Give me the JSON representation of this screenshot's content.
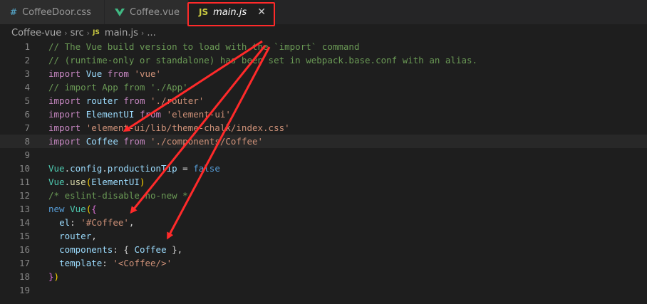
{
  "tabs": [
    {
      "label": "CoffeeDoor.css",
      "icon": "css-hash-icon"
    },
    {
      "label": "Coffee.vue",
      "icon": "vue-icon"
    },
    {
      "label": "main.js",
      "icon": "js-icon",
      "icon_text": "JS",
      "active": true,
      "close": "✕"
    }
  ],
  "breadcrumb": {
    "items": [
      "Coffee-vue",
      "src",
      "main.js",
      "..."
    ],
    "js_badge": "JS",
    "separator": "›"
  },
  "editor": {
    "current_line": 8,
    "lines": [
      {
        "n": "1",
        "tokens": [
          [
            "c-cm",
            "// The Vue build version to load with the `import` command"
          ]
        ]
      },
      {
        "n": "2",
        "tokens": [
          [
            "c-cm",
            "// (runtime-only or standalone) has been set in webpack.base.conf with an alias."
          ]
        ]
      },
      {
        "n": "3",
        "tokens": [
          [
            "c-kw2",
            "import"
          ],
          [
            "",
            " "
          ],
          [
            "c-var",
            "Vue"
          ],
          [
            "",
            " "
          ],
          [
            "c-kw2",
            "from"
          ],
          [
            "",
            " "
          ],
          [
            "c-str",
            "'vue'"
          ]
        ]
      },
      {
        "n": "4",
        "tokens": [
          [
            "c-cm",
            "// import App from './App'"
          ]
        ]
      },
      {
        "n": "5",
        "tokens": [
          [
            "c-kw2",
            "import"
          ],
          [
            "",
            " "
          ],
          [
            "c-var",
            "router"
          ],
          [
            "",
            " "
          ],
          [
            "c-kw2",
            "from"
          ],
          [
            "",
            " "
          ],
          [
            "c-str",
            "'./router'"
          ]
        ]
      },
      {
        "n": "6",
        "tokens": [
          [
            "c-kw2",
            "import"
          ],
          [
            "",
            " "
          ],
          [
            "c-var",
            "ElementUI"
          ],
          [
            "",
            " "
          ],
          [
            "c-kw2",
            "from"
          ],
          [
            "",
            " "
          ],
          [
            "c-str",
            "'element-ui'"
          ]
        ]
      },
      {
        "n": "7",
        "tokens": [
          [
            "c-kw2",
            "import"
          ],
          [
            "",
            " "
          ],
          [
            "c-str",
            "'element-ui/lib/theme-chalk/index.css'"
          ]
        ]
      },
      {
        "n": "8",
        "tokens": [
          [
            "c-kw2",
            "import"
          ],
          [
            "",
            " "
          ],
          [
            "c-var",
            "Coffee"
          ],
          [
            "",
            " "
          ],
          [
            "c-kw2",
            "from"
          ],
          [
            "",
            " "
          ],
          [
            "c-str",
            "'./components/Coffee'"
          ]
        ]
      },
      {
        "n": "9",
        "tokens": []
      },
      {
        "n": "10",
        "tokens": [
          [
            "c-cls",
            "Vue"
          ],
          [
            "",
            "."
          ],
          [
            "c-var",
            "config"
          ],
          [
            "",
            "."
          ],
          [
            "c-var",
            "productionTip"
          ],
          [
            "",
            " = "
          ],
          [
            "c-kw",
            "false"
          ]
        ]
      },
      {
        "n": "11",
        "tokens": [
          [
            "c-cls",
            "Vue"
          ],
          [
            "",
            "."
          ],
          [
            "c-fn",
            "use"
          ],
          [
            "c-br",
            "("
          ],
          [
            "c-var",
            "ElementUI"
          ],
          [
            "c-br",
            ")"
          ]
        ]
      },
      {
        "n": "12",
        "tokens": [
          [
            "c-cm",
            "/* eslint-disable no-new */"
          ]
        ]
      },
      {
        "n": "13",
        "tokens": [
          [
            "c-kw",
            "new"
          ],
          [
            "",
            " "
          ],
          [
            "c-cls",
            "Vue"
          ],
          [
            "c-br",
            "("
          ],
          [
            "c-br2",
            "{"
          ]
        ]
      },
      {
        "n": "14",
        "tokens": [
          [
            "",
            "  "
          ],
          [
            "c-var",
            "el"
          ],
          [
            "",
            ": "
          ],
          [
            "c-str",
            "'#Coffee'"
          ],
          [
            "",
            ","
          ]
        ]
      },
      {
        "n": "15",
        "tokens": [
          [
            "",
            "  "
          ],
          [
            "c-var",
            "router"
          ],
          [
            "",
            ","
          ]
        ]
      },
      {
        "n": "16",
        "tokens": [
          [
            "",
            "  "
          ],
          [
            "c-var",
            "components"
          ],
          [
            "",
            ": { "
          ],
          [
            "c-var",
            "Coffee"
          ],
          [
            "",
            " },"
          ]
        ]
      },
      {
        "n": "17",
        "tokens": [
          [
            "",
            "  "
          ],
          [
            "c-var",
            "template"
          ],
          [
            "",
            ": "
          ],
          [
            "c-str",
            "'<Coffee/>'"
          ]
        ]
      },
      {
        "n": "18",
        "tokens": [
          [
            "c-br2",
            "}"
          ],
          [
            "c-br",
            ")"
          ]
        ]
      },
      {
        "n": "19",
        "tokens": []
      }
    ]
  },
  "colors": {
    "annotation": "#ff2a2a",
    "background": "#1e1e1e",
    "tabbar": "#252526"
  }
}
